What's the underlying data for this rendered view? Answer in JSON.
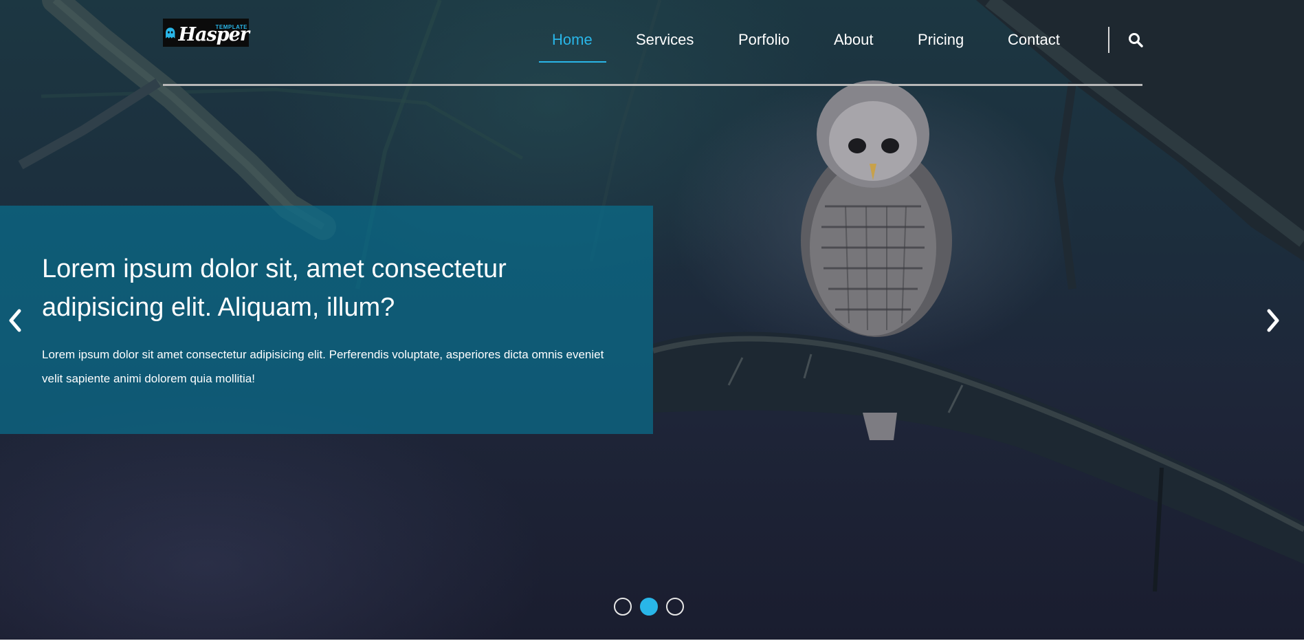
{
  "brand": {
    "name": "Hasper",
    "tagline": "TEMPLATE",
    "icon": "ghost-icon",
    "accent_color": "#29b6e8"
  },
  "nav": {
    "items": [
      {
        "label": "Home",
        "active": true
      },
      {
        "label": "Services",
        "active": false
      },
      {
        "label": "Porfolio",
        "active": false
      },
      {
        "label": "About",
        "active": false
      },
      {
        "label": "Pricing",
        "active": false
      },
      {
        "label": "Contact",
        "active": false
      }
    ],
    "search_icon": "search-icon"
  },
  "slider": {
    "background_image": "owl-on-branch-at-night",
    "caption": {
      "title": "Lorem ipsum dolor sit, amet consectetur adipisicing elit. Aliquam, illum?",
      "text": "Lorem ipsum dolor sit amet consectetur adipisicing elit. Perferendis voluptate, asperiores dicta omnis eveniet velit sapiente animi dolorem quia mollitia!"
    },
    "prev_icon": "chevron-left-icon",
    "next_icon": "chevron-right-icon",
    "slide_count": 3,
    "active_slide": 2,
    "caption_color": "#0a6e8c"
  }
}
